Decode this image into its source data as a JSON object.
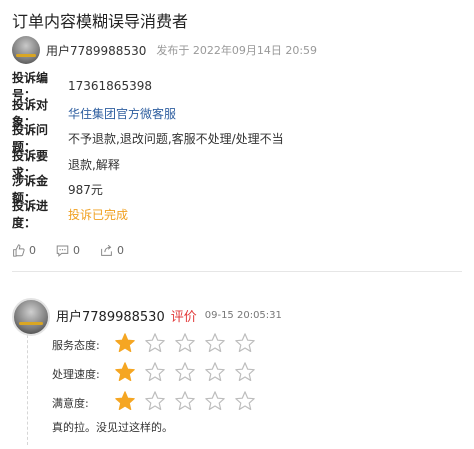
{
  "title": "订单内容模糊误导消费者",
  "author": {
    "name": "用户7789988530",
    "posted": "发布于 2022年09月14日 20:59"
  },
  "info": [
    {
      "label": "投诉编号：",
      "value": "17361865398",
      "style": ""
    },
    {
      "label": "投诉对象：",
      "value": "华住集团官方微客服",
      "style": "link"
    },
    {
      "label": "投诉问题：",
      "value": "不予退款,退改问题,客服不处理/处理不当",
      "style": ""
    },
    {
      "label": "投诉要求：",
      "value": "退款,解释",
      "style": ""
    },
    {
      "label": "涉诉金额：",
      "value": "987元",
      "style": ""
    },
    {
      "label": "投诉进度：",
      "value": "投诉已完成",
      "style": "status"
    }
  ],
  "actions": {
    "like": "0",
    "comment": "0",
    "share": "0"
  },
  "review": {
    "user": "用户7789988530",
    "tag": "评价",
    "time": "09-15 20:05:31",
    "ratings": [
      {
        "label": "服务态度:",
        "stars": 1,
        "max": 5
      },
      {
        "label": "处理速度:",
        "stars": 1,
        "max": 5
      },
      {
        "label": "满意度:",
        "stars": 1,
        "max": 5
      }
    ],
    "comment": "真的拉。没见过这样的。"
  },
  "colors": {
    "star_filled": "#f5a623",
    "star_empty": "#bdbdbd",
    "link": "#2f5fa0",
    "status": "#f0a020",
    "tag": "#e23a3a"
  }
}
